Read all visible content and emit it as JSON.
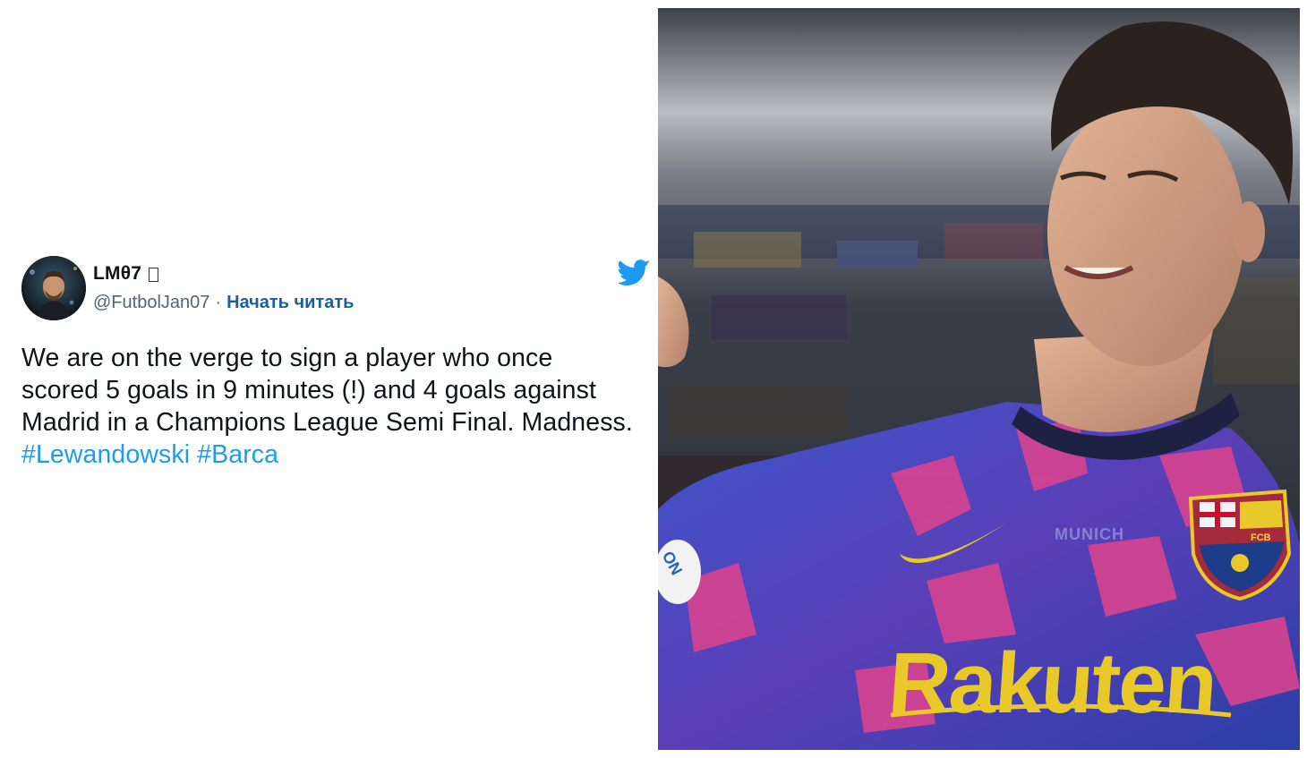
{
  "tweet": {
    "display_name": "LMθ7",
    "handle": "@FutbolJan07",
    "separator": "·",
    "follow_label": "Начать читать",
    "text_lines": [
      "We are on the verge to sign a player who once",
      "scored 5 goals in 9 minutes (!) and 4 goals against",
      "Madrid in a Champions League Semi Final. Madness."
    ],
    "hashtags": [
      "#Lewandowski",
      "#Barca"
    ],
    "brand_icon": "twitter-bird-icon",
    "brand_color": "#1d9bf0",
    "link_color": "#1b5fa0"
  },
  "photo": {
    "sponsor_text": "Rakuten",
    "print_text": "MUNICH",
    "crest_text": "FCB",
    "patch_text": "ON",
    "sponsor_color": "#e9c92a"
  }
}
